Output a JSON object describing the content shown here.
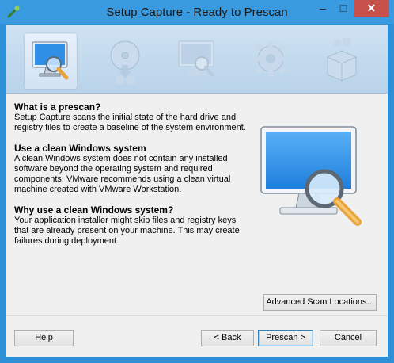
{
  "window": {
    "title": "Setup Capture - Ready to Prescan",
    "minimize": "–",
    "maximize": "□",
    "close": "✕"
  },
  "steps": [
    {
      "icon": "prescan-monitor-magnifier-icon",
      "active": true
    },
    {
      "icon": "install-disc-icon",
      "active": false
    },
    {
      "icon": "postscan-monitor-icon",
      "active": false
    },
    {
      "icon": "configure-gear-icon",
      "active": false
    },
    {
      "icon": "package-box-icon",
      "active": false
    }
  ],
  "sections": [
    {
      "heading": "What is a prescan?",
      "body": "Setup Capture scans the initial state of the hard drive and registry files to create a baseline of the system environment."
    },
    {
      "heading": "Use a clean Windows system",
      "body": "A clean Windows system does not contain any installed software beyond the operating system and required components. VMware recommends using a clean virtual machine created with VMware Workstation."
    },
    {
      "heading": "Why use a clean Windows system?",
      "body": "Your application installer might skip files and registry keys that are already present on your machine. This may create failures during deployment."
    }
  ],
  "buttons": {
    "advanced": "Advanced Scan Locations...",
    "help": "Help",
    "back": "< Back",
    "prescan": "Prescan >",
    "cancel": "Cancel"
  },
  "colors": {
    "titlebar": "#3a9ae0",
    "close_button": "#c7504b",
    "monitor_screen": "#2f8ee6"
  }
}
